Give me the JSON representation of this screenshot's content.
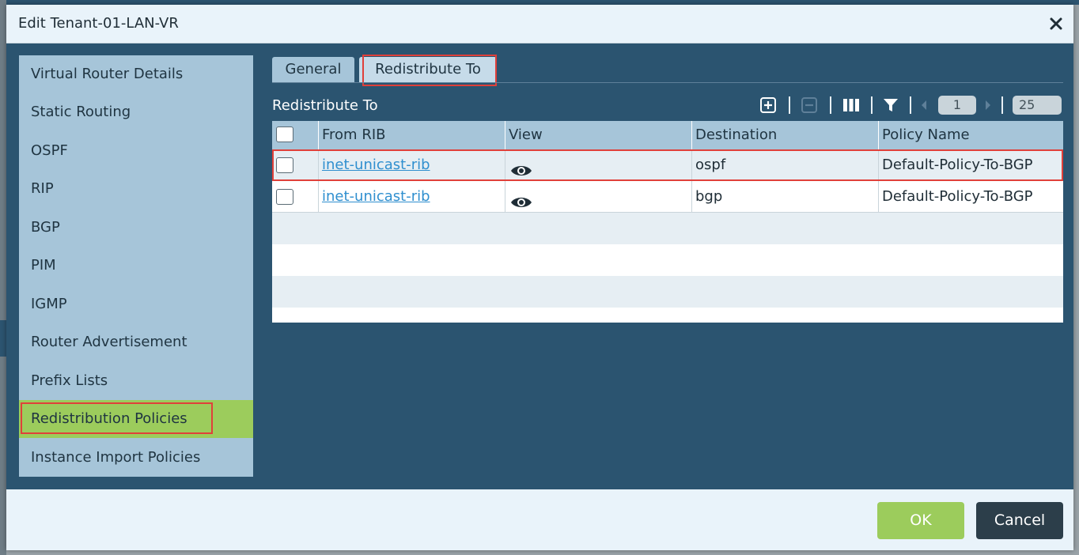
{
  "dialog": {
    "title": "Edit Tenant-01-LAN-VR",
    "close_icon": "close-icon"
  },
  "sidebar": {
    "items": [
      {
        "label": "Virtual Router Details"
      },
      {
        "label": "Static Routing"
      },
      {
        "label": "OSPF"
      },
      {
        "label": "RIP"
      },
      {
        "label": "BGP"
      },
      {
        "label": "PIM"
      },
      {
        "label": "IGMP"
      },
      {
        "label": "Router Advertisement"
      },
      {
        "label": "Prefix Lists"
      },
      {
        "label": "Redistribution Policies",
        "active": true
      },
      {
        "label": "Instance Import Policies"
      }
    ]
  },
  "tabs": [
    {
      "label": "General"
    },
    {
      "label": "Redistribute To",
      "active": true
    }
  ],
  "section": {
    "title": "Redistribute To"
  },
  "toolbar": {
    "page": "1",
    "page_size": "25",
    "icons": [
      "add-icon",
      "remove-icon",
      "columns-icon",
      "filter-icon",
      "prev-page-icon",
      "next-page-icon"
    ]
  },
  "grid": {
    "columns": [
      "From RIB",
      "View",
      "Destination",
      "Policy Name"
    ],
    "rows": [
      {
        "from_rib": "inet-unicast-rib",
        "destination": "ospf",
        "policy_name": "Default-Policy-To-BGP"
      },
      {
        "from_rib": "inet-unicast-rib",
        "destination": "bgp",
        "policy_name": "Default-Policy-To-BGP"
      }
    ]
  },
  "footer": {
    "ok_label": "OK",
    "cancel_label": "Cancel"
  },
  "colors": {
    "accent": "#9ccc5c",
    "highlight": "#e0403a",
    "dialog_bg": "#2b5470"
  }
}
